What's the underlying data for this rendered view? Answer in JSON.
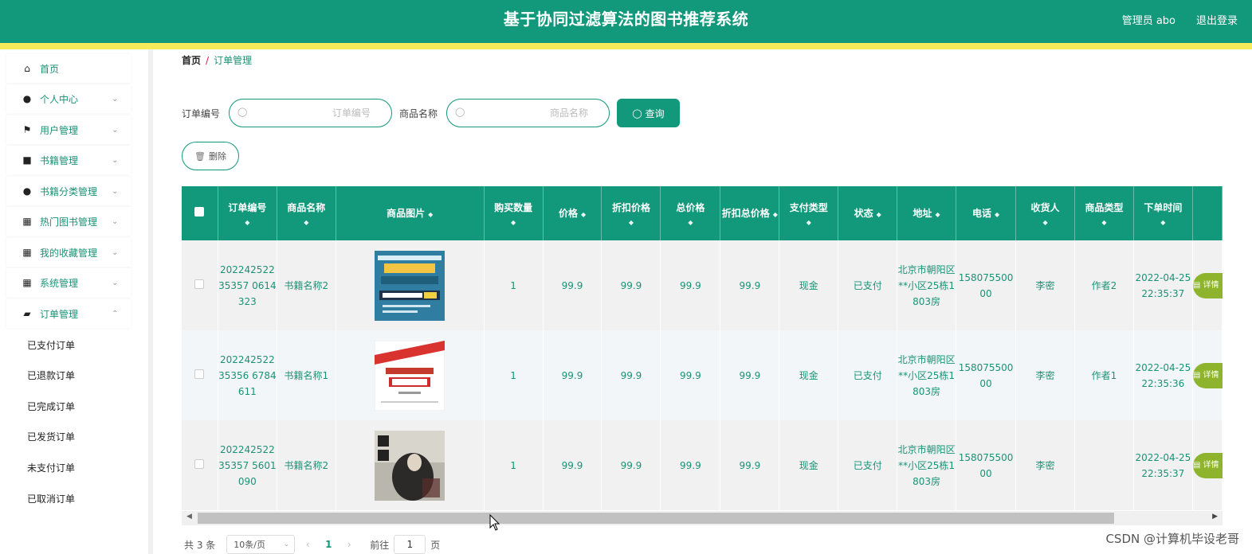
{
  "header": {
    "title": "基于协同过滤算法的图书推荐系统",
    "user": "管理员 abo",
    "logout": "退出登录"
  },
  "sidebar": {
    "items": [
      {
        "label": "首页",
        "icon": "home-icon"
      },
      {
        "label": "个人中心",
        "icon": "user-icon"
      },
      {
        "label": "用户管理",
        "icon": "flag-icon"
      },
      {
        "label": "书籍管理",
        "icon": "briefcase-icon"
      },
      {
        "label": "书籍分类管理",
        "icon": "user-icon"
      },
      {
        "label": "热门图书管理",
        "icon": "grid-icon"
      },
      {
        "label": "我的收藏管理",
        "icon": "grid-icon"
      },
      {
        "label": "系统管理",
        "icon": "grid-icon"
      },
      {
        "label": "订单管理",
        "icon": "cart-icon"
      }
    ],
    "sub_items": [
      "已支付订单",
      "已退款订单",
      "已完成订单",
      "已发货订单",
      "未支付订单",
      "已取消订单"
    ]
  },
  "breadcrumb": {
    "home": "首页",
    "current": "订单管理"
  },
  "search": {
    "order_label": "订单编号",
    "order_placeholder": "订单编号",
    "product_label": "商品名称",
    "product_placeholder": "商品名称",
    "query_button": "查询"
  },
  "delete_button": "删除",
  "table": {
    "headers": [
      "订单编号",
      "商品名称",
      "商品图片",
      "购买数量",
      "价格",
      "折扣价格",
      "总价格",
      "折扣总价格",
      "支付类型",
      "状态",
      "地址",
      "电话",
      "收货人",
      "商品类型",
      "下单时间"
    ],
    "rows": [
      {
        "order_no": "20224252235357 0614323",
        "name": "书籍名称2",
        "qty": "1",
        "price": "99.9",
        "disc_price": "99.9",
        "total": "99.9",
        "disc_total": "99.9",
        "pay_type": "现金",
        "status": "已支付",
        "address": "北京市朝阳区**小区25栋1803房",
        "phone": "15807550000",
        "receiver": "李密",
        "type": "作者2",
        "time": "2022-04-25 22:35:37"
      },
      {
        "order_no": "20224252235356 6784611",
        "name": "书籍名称1",
        "qty": "1",
        "price": "99.9",
        "disc_price": "99.9",
        "total": "99.9",
        "disc_total": "99.9",
        "pay_type": "现金",
        "status": "已支付",
        "address": "北京市朝阳区**小区25栋1803房",
        "phone": "15807550000",
        "receiver": "李密",
        "type": "作者1",
        "time": "2022-04-25 22:35:36"
      },
      {
        "order_no": "20224252235357 5601090",
        "name": "书籍名称2",
        "qty": "1",
        "price": "99.9",
        "disc_price": "99.9",
        "total": "99.9",
        "disc_total": "99.9",
        "pay_type": "现金",
        "status": "已支付",
        "address": "北京市朝阳区**小区25栋1803房",
        "phone": "15807550000",
        "receiver": "李密",
        "type": "",
        "time": "2022-04-25 22:35:37"
      }
    ],
    "detail_button": "详情"
  },
  "pagination": {
    "total": "共 3 条",
    "page_size": "10条/页",
    "current_page": "1",
    "goto_label": "前往",
    "goto_value": "1",
    "goto_suffix": "页"
  },
  "watermark": "CSDN @计算机毕设老哥",
  "colors": {
    "primary": "#12987a",
    "accent_bar": "#f6ea5a",
    "detail_button": "#8db42c"
  }
}
